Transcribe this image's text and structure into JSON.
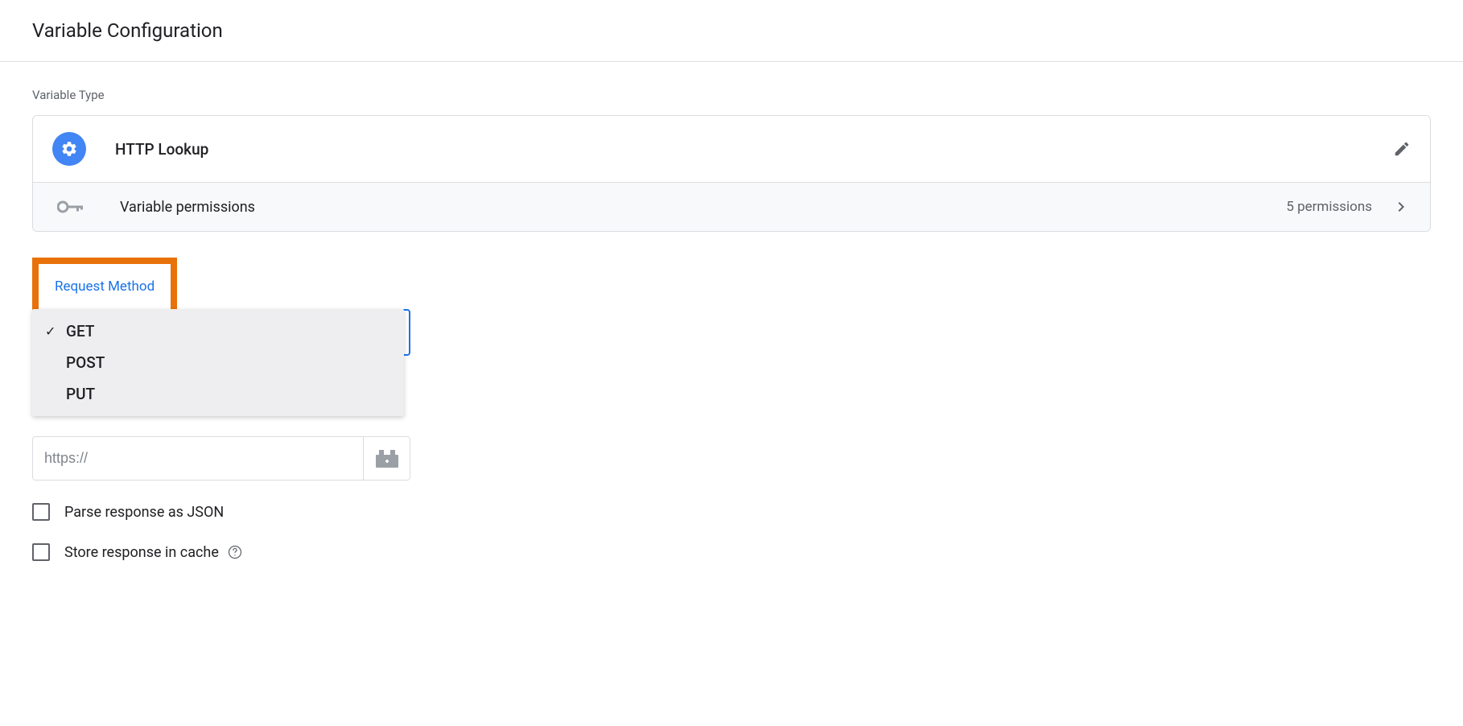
{
  "header": {
    "title": "Variable Configuration"
  },
  "variableType": {
    "sectionLabel": "Variable Type",
    "name": "HTTP Lookup",
    "permissionsLabel": "Variable permissions",
    "permissionsCount": "5 permissions"
  },
  "requestMethod": {
    "label": "Request Method",
    "options": [
      {
        "label": "GET",
        "selected": true
      },
      {
        "label": "POST",
        "selected": false
      },
      {
        "label": "PUT",
        "selected": false
      }
    ]
  },
  "urlInput": {
    "placeholder": "https://"
  },
  "checkboxes": {
    "parseJson": "Parse response as JSON",
    "storeCache": "Store response in cache"
  }
}
